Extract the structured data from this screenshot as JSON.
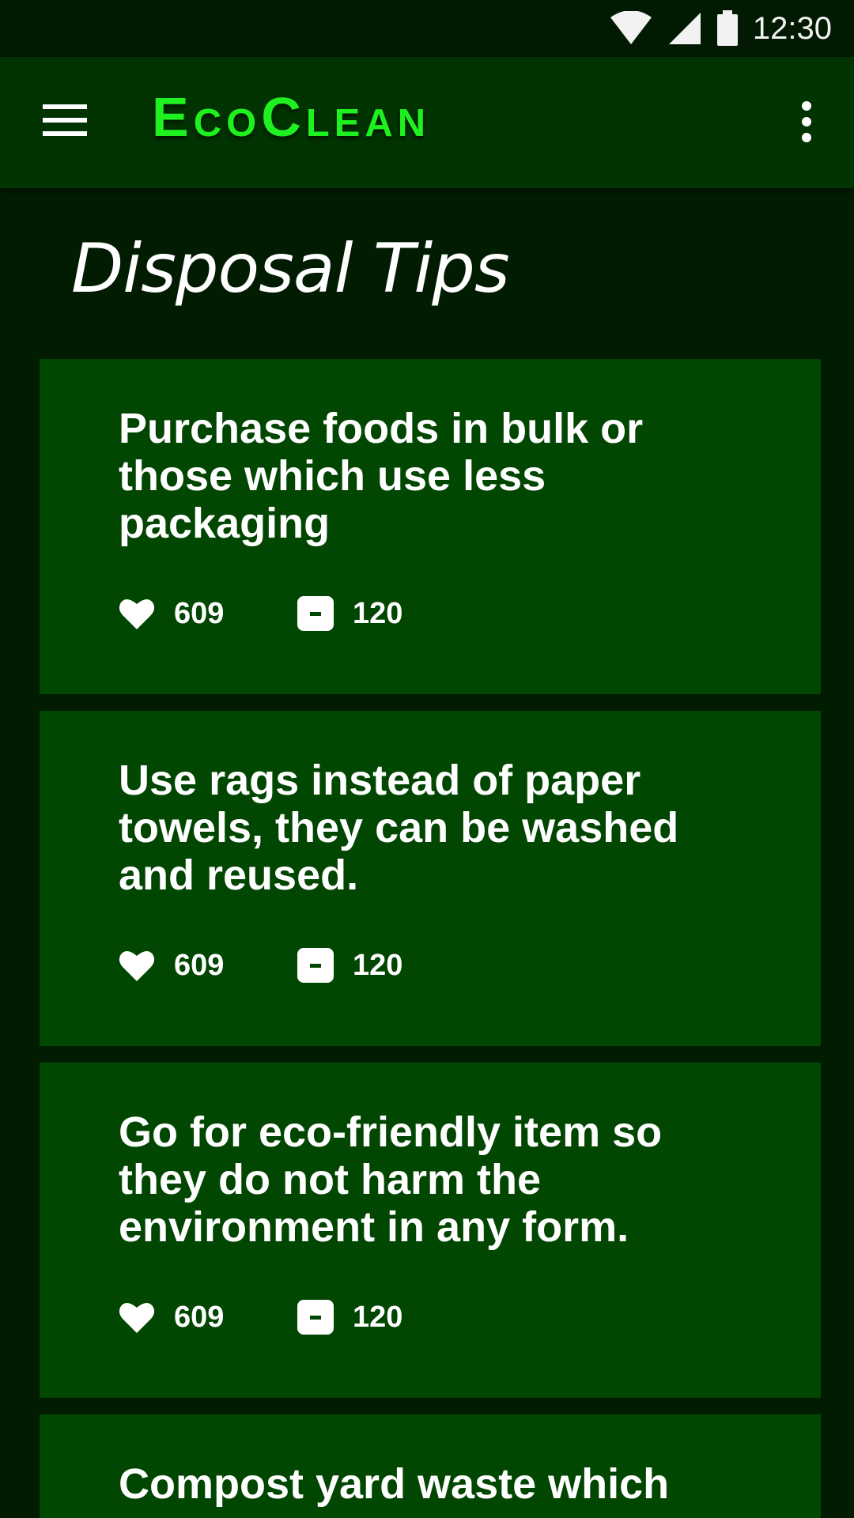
{
  "status_bar": {
    "time": "12:30",
    "icons": [
      "wifi-icon",
      "signal-icon",
      "battery-icon"
    ]
  },
  "app_bar": {
    "title": "EcoClean",
    "menu_icon": "menu-icon",
    "overflow_icon": "more-vert-icon"
  },
  "page": {
    "heading": "Disposal Tips"
  },
  "tips": [
    {
      "title": "Purchase foods in bulk or those which use less packaging",
      "likes": "609",
      "comments": "120"
    },
    {
      "title": "Use rags instead of paper towels, they can be washed and reused.",
      "likes": "609",
      "comments": "120"
    },
    {
      "title": "Go for eco-friendly item so they do not harm the environment in any form.",
      "likes": "609",
      "comments": "120"
    },
    {
      "title": "Compost yard waste which",
      "likes": "",
      "comments": ""
    }
  ],
  "colors": {
    "background": "#021c02",
    "app_bar": "#023402",
    "card": "#014601",
    "accent": "#1ff01f"
  }
}
